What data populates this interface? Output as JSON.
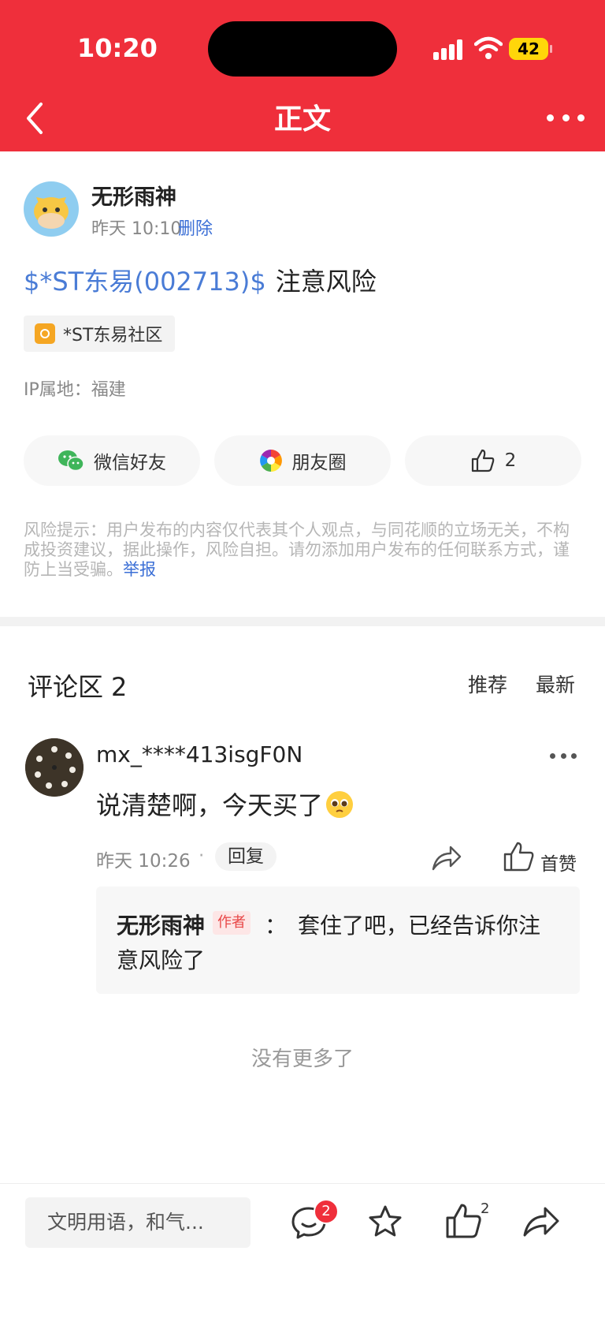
{
  "status_bar": {
    "time": "10:20",
    "battery": "42"
  },
  "header": {
    "title": "正文"
  },
  "post": {
    "author": "无形雨神",
    "time": "昨天 10:10",
    "delete_label": "删除",
    "stock_tag": "$*ST东易(002713)$",
    "text": "注意风险",
    "community": "*ST东易社区",
    "ip": "IP属地：福建"
  },
  "share": {
    "wechat_label": "微信好友",
    "moments_label": "朋友圈",
    "like_count": "2"
  },
  "risk": {
    "text": "风险提示：用户发布的内容仅代表其个人观点，与同花顺的立场无关，不构成投资建议，据此操作，风险自担。请勿添加用户发布的任何联系方式，谨防上当受骗。",
    "report_label": "举报"
  },
  "comments": {
    "title": "评论区",
    "count": "2",
    "sort_recommend": "推荐",
    "sort_latest": "最新",
    "items": [
      {
        "user": "mx_****413isgF0N",
        "text": "说清楚啊，今天买了",
        "time": "昨天 10:26",
        "dot": "·",
        "reply_label": "回复",
        "like_label": "首赞",
        "reply": {
          "name": "无形雨神",
          "badge": "作者",
          "colon": "：",
          "text": "套住了吧，已经告诉你注意风险了"
        }
      }
    ],
    "no_more": "没有更多了"
  },
  "bottom_bar": {
    "input_placeholder": "文明用语，和气...",
    "comment_badge": "2",
    "like_count": "2"
  },
  "colors": {
    "brand_red": "#ef2f3b",
    "link_blue": "#3b6fd6"
  }
}
